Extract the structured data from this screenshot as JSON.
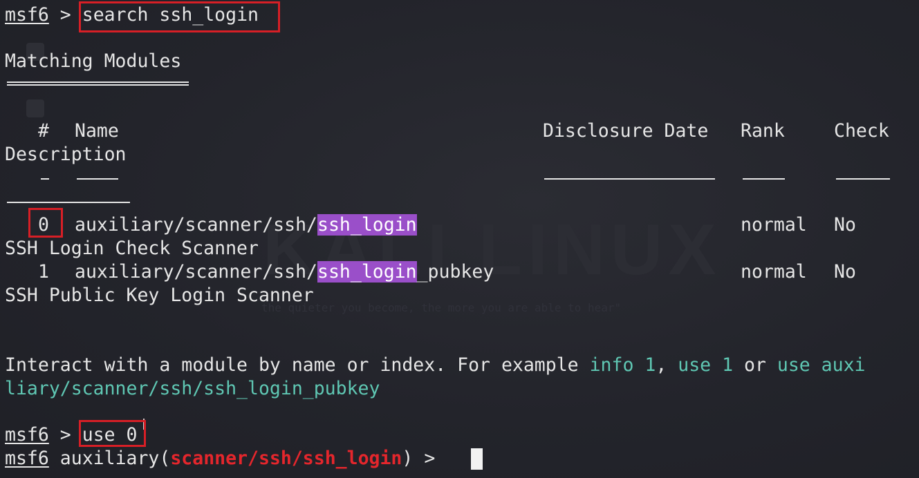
{
  "background_watermark": {
    "text": "KALI LINUX",
    "tagline": "the quieter you become, the more you are able to hear\""
  },
  "prompt": {
    "label": "msf6",
    "symbol": ">",
    "command": "search ssh_login"
  },
  "heading": "Matching Modules",
  "table": {
    "headers": {
      "index": "#",
      "name": "Name",
      "date": "Disclosure Date",
      "rank": "Rank",
      "check": "Check",
      "description": "Description"
    },
    "rows": [
      {
        "index": "0",
        "path_prefix": "auxiliary/scanner/ssh/",
        "match": "ssh_login",
        "suffix": "",
        "rank": "normal",
        "check": "No",
        "description": "SSH Login Check Scanner"
      },
      {
        "index": "1",
        "path_prefix": "auxiliary/scanner/ssh/",
        "match": "ssh_login",
        "suffix": "_pubkey",
        "rank": "normal",
        "check": "No",
        "description": "SSH Public Key Login Scanner"
      }
    ]
  },
  "hint": {
    "prefix": "Interact with a module by name or index. For example ",
    "example1": "info 1",
    "sep1": ", ",
    "example2": "use 1",
    "sep2": " or ",
    "example3_part1": "use auxi",
    "example3_part2": "liary/scanner/ssh/ssh_login_pubkey"
  },
  "prompt2": {
    "label": "msf6",
    "symbol": ">",
    "command": "use 0"
  },
  "prompt3": {
    "label": "msf6",
    "module_type": "auxiliary(",
    "module_name": "scanner/ssh/ssh_login",
    "close": ")",
    "symbol": ">"
  },
  "colors": {
    "background": "#23242b",
    "text": "#e6e6e6",
    "highlight": "#9a4fc9",
    "hint_accent": "#5fc7b3",
    "module_red": "#e4262c",
    "annotation_box": "#d71f26"
  }
}
